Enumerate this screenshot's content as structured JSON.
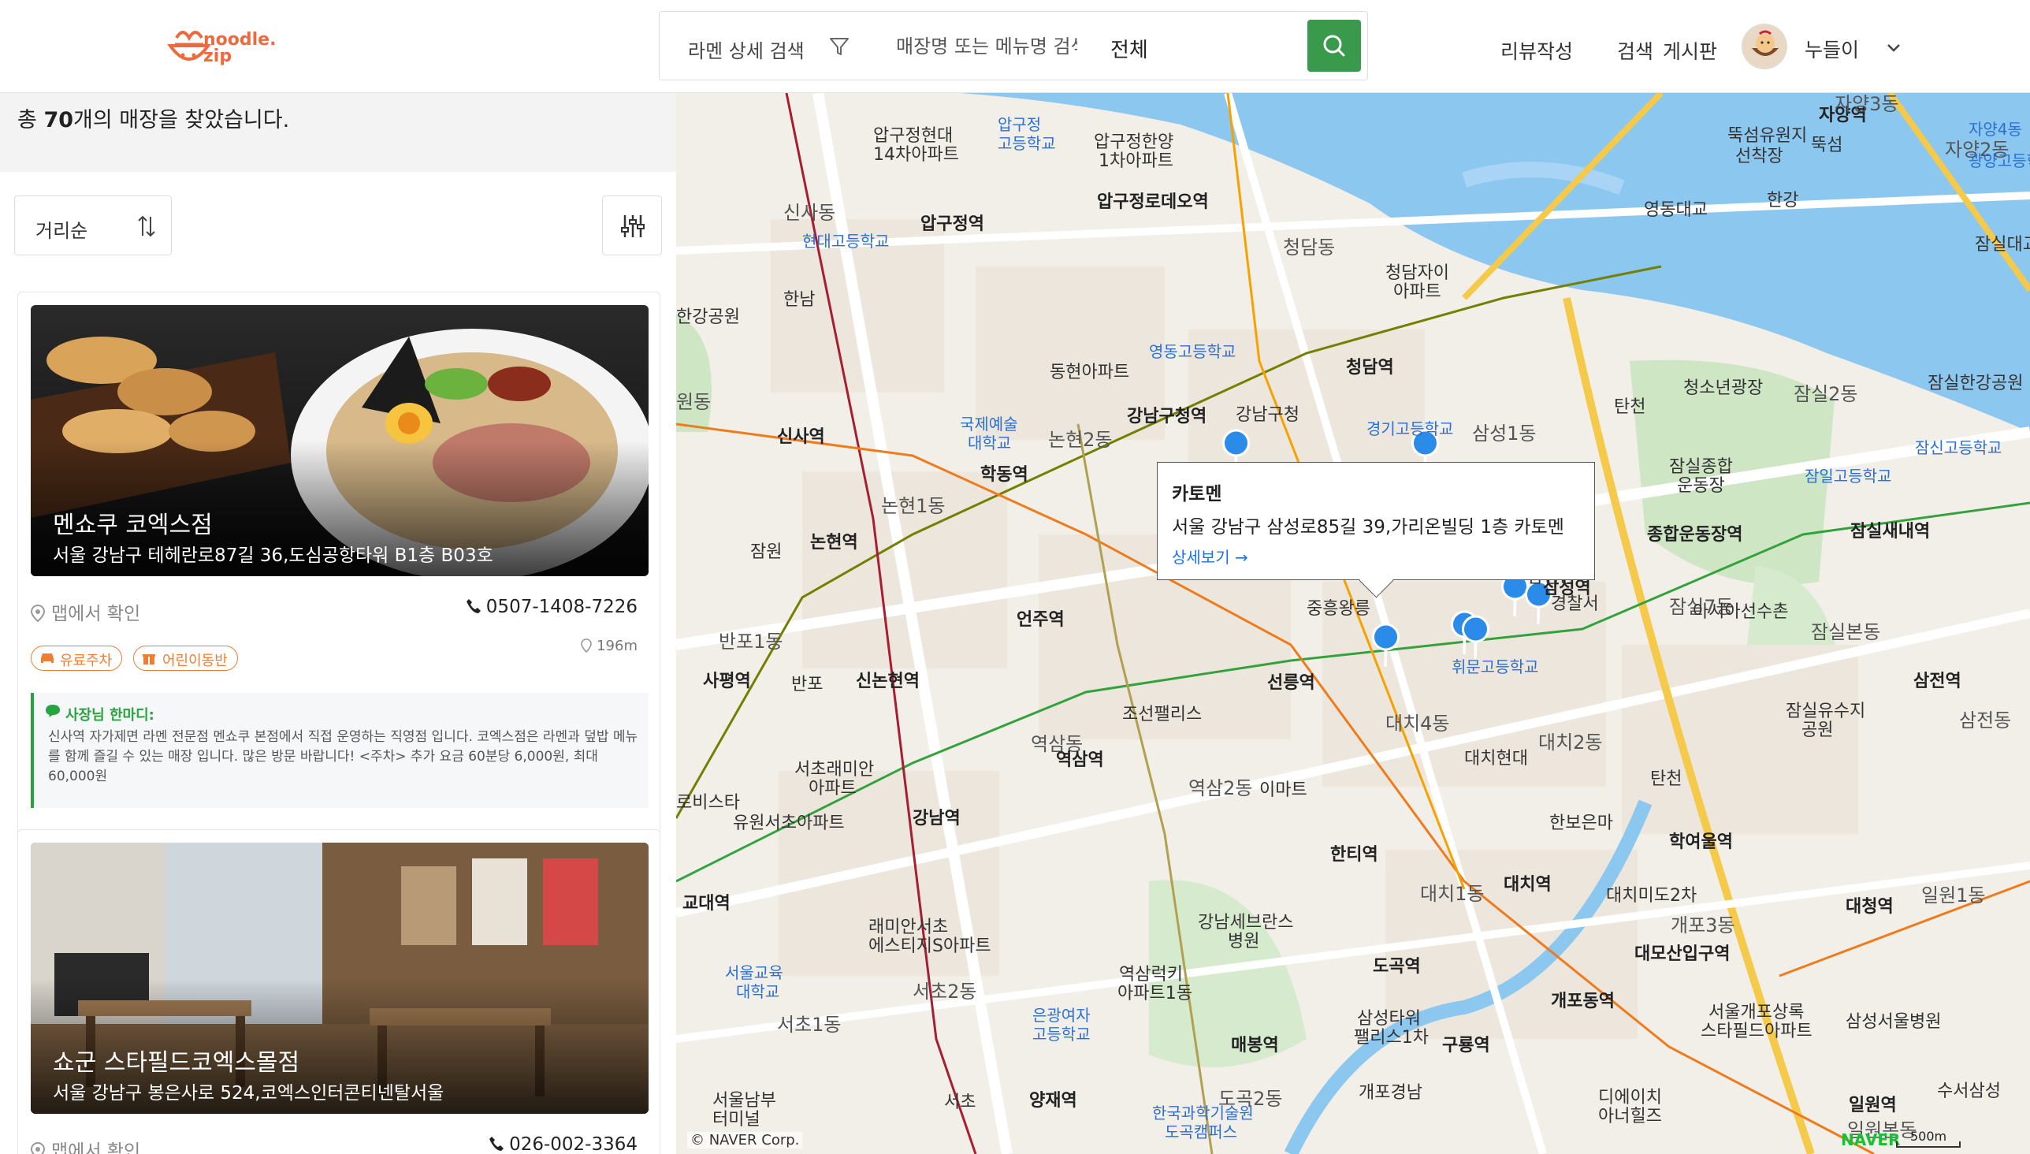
{
  "header": {
    "logo_text_1": "noodle.",
    "logo_text_2": "zip",
    "search_detail_label": "라멘 상세 검색",
    "search_placeholder": "매장명 또는 메뉴명 검색",
    "region_value": "전체",
    "nav_items": [
      "리뷰작성",
      "검색",
      "게시판"
    ],
    "username": "누들이"
  },
  "results": {
    "prefix": "총 ",
    "count": "70",
    "suffix": "개의 매장을 찾았습니다."
  },
  "sort": {
    "label": "거리순"
  },
  "stores": [
    {
      "name": "멘쇼쿠 코엑스점",
      "address": "서울 강남구 테헤란로87길 36,도심공항타워 B1층 B03호",
      "map_link": "맵에서 확인",
      "phone": "0507-1408-7226",
      "distance": "196m",
      "tags": [
        "유료주차",
        "어린이동반"
      ],
      "owner_title": "사장님 한마디:",
      "owner_text": "신사역 자가제면 라멘 전문점 멘쇼쿠 본점에서 직접 운영하는 직영점 입니다. 코엑스점은 라멘과 덮밥 메뉴를 함께 즐길 수 있는 매장 입니다. 많은 방문 바랍니다! <주차> 추가 요금 60분당 6,000원, 최대 60,000원"
    },
    {
      "name": "쇼군 스타필드코엑스몰점",
      "address": "서울 강남구 봉은사로 524,코엑스인터콘티넨탈서울",
      "map_link": "맵에서 확인",
      "phone": "026-002-3364"
    }
  ],
  "map": {
    "popup": {
      "name": "카토멘",
      "address": "서울 강남구 삼성로85길 39,가리온빌딩 1층 카토멘",
      "link": "상세보기 →"
    },
    "labels": {
      "l1": "자양역",
      "l2": "자양3동",
      "l3": "뚝섬",
      "l4": "자양2동",
      "l5": "광양고등학교",
      "l6": "뚝섬유원지",
      "l7": "선착장",
      "l8": "한강",
      "l9": "영동대교",
      "l10": "압구정현대",
      "l11": "14차아파트",
      "l12": "압구정",
      "l13": "고등학교",
      "l14": "압구정한양",
      "l15": "1차아파트",
      "l16": "압구정로데오역",
      "l17": "신사동",
      "l18": "현대고등학교",
      "l19": "압구정역",
      "l20": "청담동",
      "l21": "청담자이",
      "l22": "아파트",
      "l23": "한남",
      "l24": "한강공원",
      "l25": "영동고등학교",
      "l26": "동현아파트",
      "l27": "청담역",
      "l28": "경기고등학교",
      "l29": "삼성1동",
      "l30": "탄천",
      "l31": "청소년광장",
      "l32": "잠실2동",
      "l33": "잠실한강공원",
      "l34": "신사역",
      "l35": "국제예술",
      "l36": "대학교",
      "l37": "논현2동",
      "l38": "강남구청역",
      "l39": "강남구청",
      "l40": "학동역",
      "l41": "잠실종합",
      "l42": "운동장",
      "l43": "잠일고등학교",
      "l44": "잠신고등학교",
      "l45": "논현역",
      "l46": "논현1동",
      "l47": "잠원",
      "l48": "종합운동장역",
      "l49": "잠실새내역",
      "l50": "반포1동",
      "l51": "언주역",
      "l52": "삼성역",
      "l53": "잠실7동",
      "l54": "아시아선수촌",
      "l55": "잠실본동",
      "l56": "사평역",
      "l57": "반포",
      "l58": "신논현역",
      "l59": "선릉역",
      "l60": "휘문고등학교",
      "l61": "조선팰리스",
      "l62": "대치4동",
      "l63": "잠실유수지",
      "l64": "공원",
      "l65": "삼전역",
      "l66": "역삼동",
      "l67": "역삼역",
      "l68": "서초래미안",
      "l69": "아파트",
      "l70": "대치현대",
      "l71": "대치2동",
      "l72": "역삼2동",
      "l73": "이마트",
      "l74": "탄천",
      "l75": "삼전동",
      "l76": "강남역",
      "l77": "유원서초아파트",
      "l78": "한보은마",
      "l79": "학여울역",
      "l80": "한티역",
      "l81": "교대역",
      "l82": "대치1동",
      "l83": "대치역",
      "l84": "대치미도2차",
      "l85": "대청역",
      "l86": "일원1동",
      "l87": "강남세브란스",
      "l88": "병원",
      "l89": "래미안서초",
      "l90": "에스티지S아파트",
      "l91": "개포3동",
      "l92": "대모산입구역",
      "l93": "서울교육",
      "l94": "대학교",
      "l95": "서초2동",
      "l96": "역삼럭키",
      "l97": "아파트1동",
      "l98": "도곡역",
      "l99": "개포동역",
      "l100": "서초1동",
      "l101": "은광여자",
      "l102": "고등학교",
      "l103": "삼성타워",
      "l104": "팰리스1차",
      "l105": "구룡역",
      "l106": "서울개포상록",
      "l107": "스타필드아파트",
      "l108": "삼성서울병원",
      "l109": "매봉역",
      "l110": "서울남부",
      "l111": "터미널",
      "l112": "서초",
      "l113": "양재역",
      "l114": "도곡2동",
      "l115": "한국과학기술원",
      "l116": "도곡캠퍼스",
      "l117": "개포경남",
      "l118": "디에이치",
      "l119": "아너힐즈",
      "l120": "수서삼성",
      "l121": "일원역",
      "l122": "일원본동",
      "l123": "로비스타",
      "l124": "원동",
      "l125": "잠실대교",
      "l126": "자양4동",
      "l127": "삼성동",
      "l128": "경찰서",
      "l129": "청담",
      "l130": "중흥왕릉"
    },
    "copyright": "© NAVER Corp.",
    "brand": "NAVER",
    "scale": "500m"
  },
  "colors": {
    "accent": "#3a9a4c",
    "logo": "#ee6a3c",
    "tag": "#f07d34",
    "marker": "#2b8be8"
  }
}
